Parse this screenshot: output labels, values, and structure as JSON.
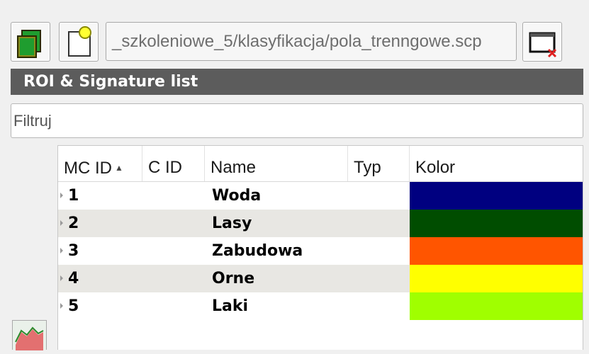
{
  "toolbar": {
    "path": "_szkoleniowe_5/klasyfikacja/pola_trenngowe.scp",
    "new_icon": "new-file-icon",
    "open_icon": "open-file-icon",
    "close_icon": "close-file-icon"
  },
  "section": {
    "title": "ROI & Signature list"
  },
  "filter": {
    "placeholder": "Filtruj"
  },
  "table": {
    "columns": [
      "MC ID",
      "C ID",
      "Name",
      "Typ",
      "Kolor"
    ],
    "sort_icon": "sort-ascending-icon",
    "rows": [
      {
        "mc_id": "1",
        "c_id": "",
        "name": "Woda",
        "typ": "",
        "color": "#000080"
      },
      {
        "mc_id": "2",
        "c_id": "",
        "name": "Lasy",
        "typ": "",
        "color": "#004d00"
      },
      {
        "mc_id": "3",
        "c_id": "",
        "name": "Zabudowa",
        "typ": "",
        "color": "#ff5500"
      },
      {
        "mc_id": "4",
        "c_id": "",
        "name": "Orne",
        "typ": "",
        "color": "#ffff00"
      },
      {
        "mc_id": "5",
        "c_id": "",
        "name": "Laki",
        "typ": "",
        "color": "#a0ff00"
      }
    ]
  },
  "side": {
    "plot_icon": "signature-plot-icon"
  }
}
